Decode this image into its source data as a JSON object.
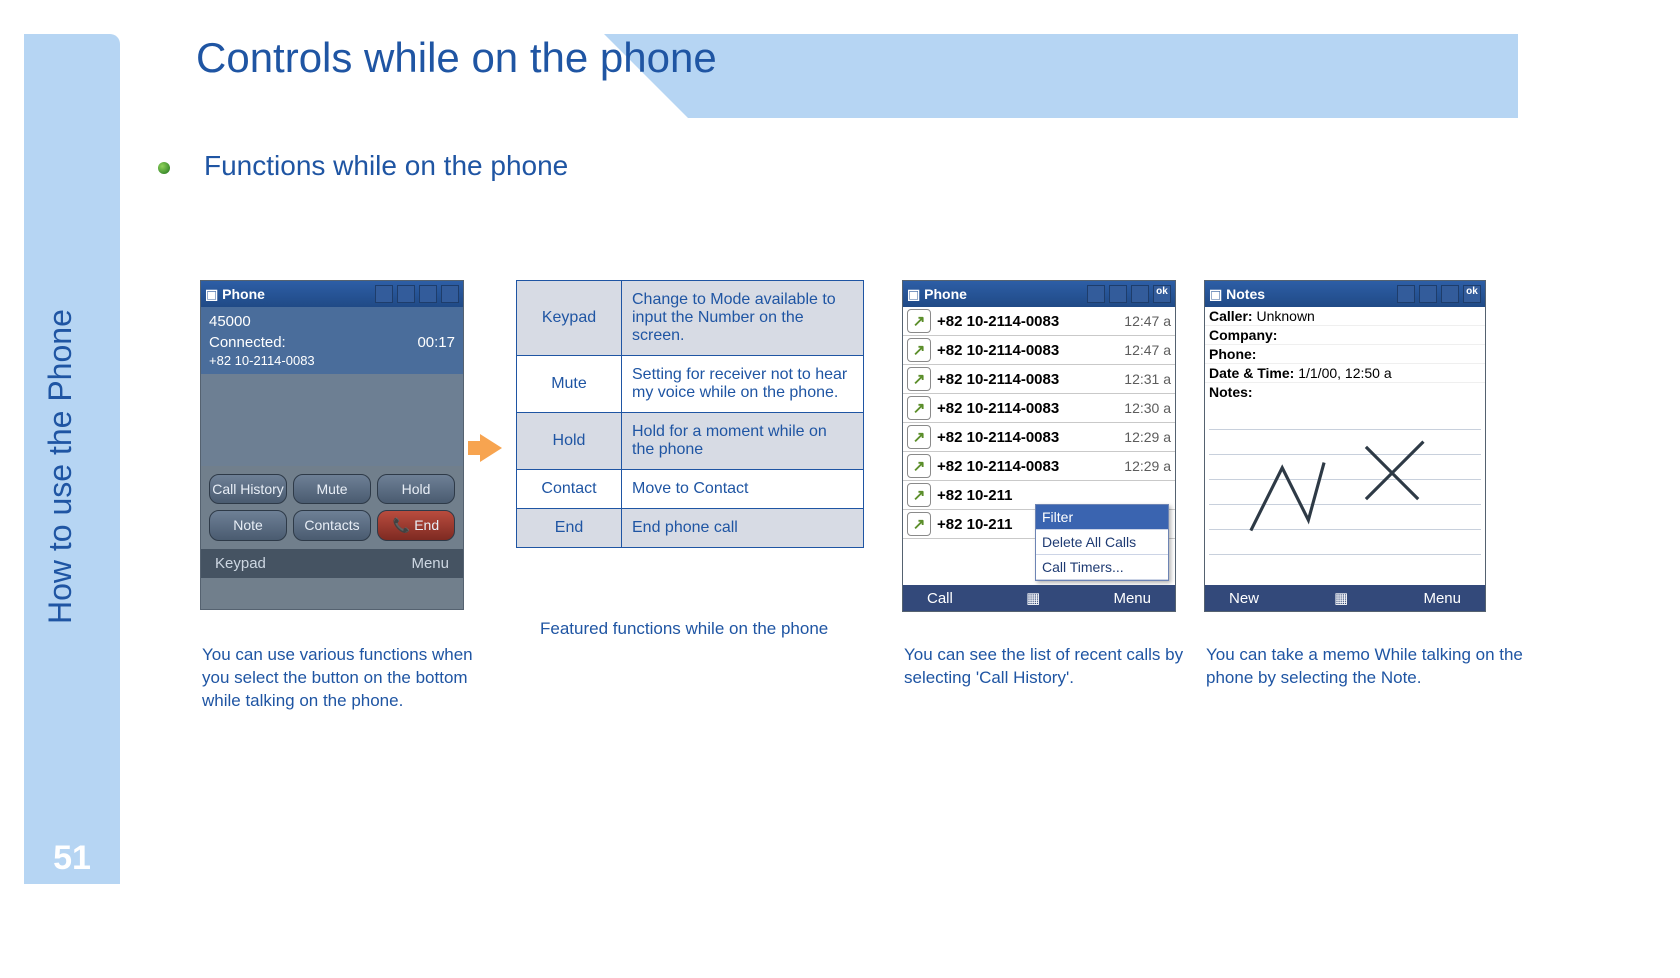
{
  "page_number": "51",
  "side_text": "How to use the Phone",
  "title": "Controls while on the phone",
  "subtitle": "Functions while on the phone",
  "shot1": {
    "window_title": "Phone",
    "display_number": "45000",
    "connected_label": "Connected:",
    "duration": "00:17",
    "remote_number": "+82 10-2114-0083",
    "buttons": [
      "Call History",
      "Mute",
      "Hold",
      "Note",
      "Contacts",
      "End"
    ],
    "softkeys": {
      "left": "Keypad",
      "right": "Menu"
    }
  },
  "caption1": "You can use various functions when you select the button on the bottom while talking on the phone.",
  "func_table": [
    {
      "k": "Keypad",
      "v": "Change to Mode available to input the Number on the screen."
    },
    {
      "k": "Mute",
      "v": "Setting for receiver not to hear my voice while on the phone."
    },
    {
      "k": "Hold",
      "v": "Hold for a moment while on the phone"
    },
    {
      "k": "Contact",
      "v": "Move to Contact"
    },
    {
      "k": "End",
      "v": "End phone call"
    }
  ],
  "table_caption": "Featured functions while on the phone",
  "shot2": {
    "window_title": "Phone",
    "rows": [
      {
        "n": "+82 10-2114-0083",
        "t": "12:47 a"
      },
      {
        "n": "+82 10-2114-0083",
        "t": "12:47 a"
      },
      {
        "n": "+82 10-2114-0083",
        "t": "12:31 a"
      },
      {
        "n": "+82 10-2114-0083",
        "t": "12:30 a"
      },
      {
        "n": "+82 10-2114-0083",
        "t": "12:29 a"
      },
      {
        "n": "+82 10-2114-0083",
        "t": "12:29 a"
      },
      {
        "n": "+82 10-211",
        "t": ""
      },
      {
        "n": "+82 10-211",
        "t": ""
      }
    ],
    "menu": [
      "Filter",
      "Delete All Calls",
      "Call Timers..."
    ],
    "softkeys": {
      "left": "Call",
      "right": "Menu"
    }
  },
  "caption2": "You can see the list of recent calls by selecting 'Call History'.",
  "shot3": {
    "window_title": "Notes",
    "fields": {
      "caller_label": "Caller:",
      "caller_value": "Unknown",
      "company_label": "Company:",
      "company_value": "",
      "phone_label": "Phone:",
      "phone_value": "",
      "datetime_label": "Date & Time:",
      "datetime_value": "1/1/00, 12:50 a",
      "notes_label": "Notes:"
    },
    "softkeys": {
      "left": "New",
      "right": "Menu"
    }
  },
  "caption3": "You can take a memo While talking on the phone by selecting the Note."
}
